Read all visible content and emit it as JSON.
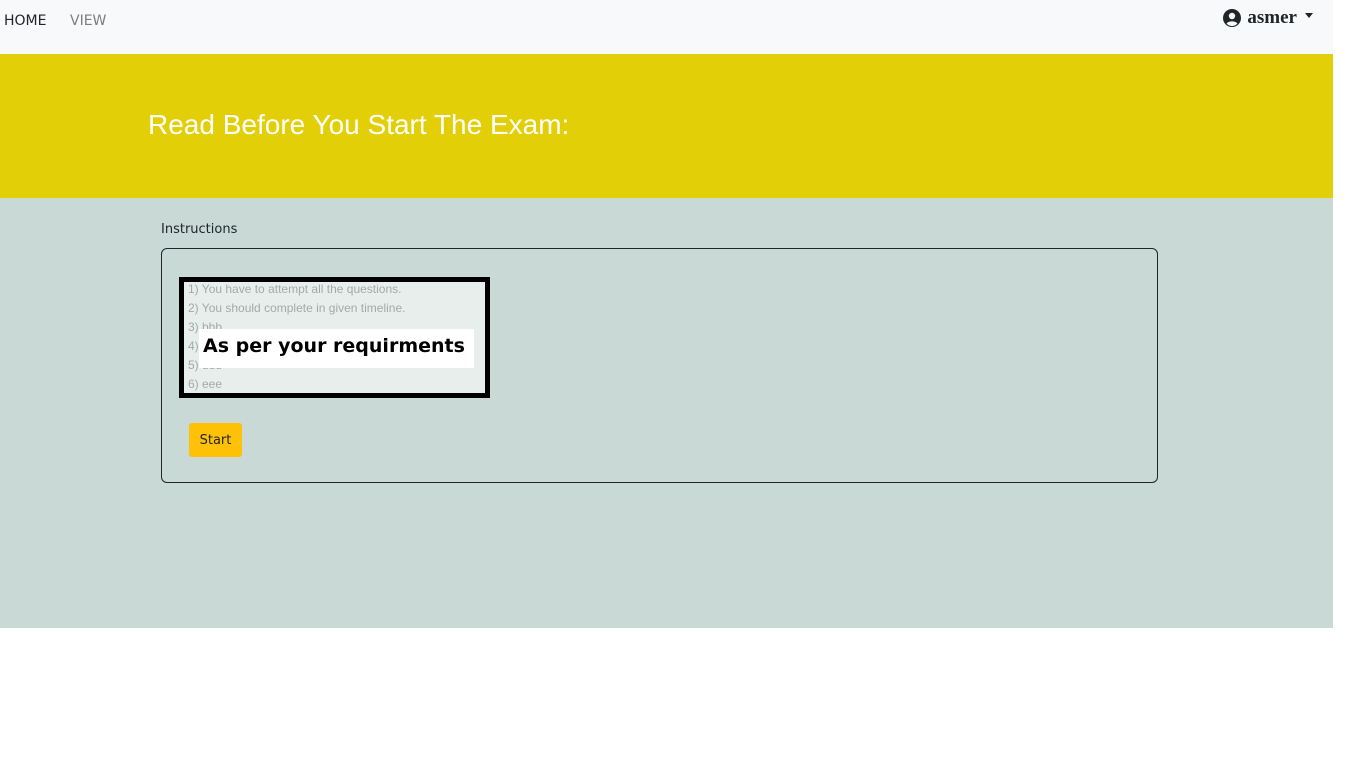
{
  "navbar": {
    "home_label": "HOME",
    "view_label": "VIEW",
    "user_name": "asmer",
    "user_icon": "user-circle-icon"
  },
  "hero": {
    "title": "Read Before You Start The Exam:"
  },
  "instructions": {
    "label": "Instructions",
    "image_lines": [
      "1) You have to attempt all the questions.",
      "2) You should complete in given timeline.",
      "3) bbb",
      "4) ccc",
      "5) ddd",
      "6) eee"
    ],
    "image_overlay_text": "As per your requirments",
    "start_button": "Start"
  },
  "colors": {
    "navbar_bg": "#f8f9fa",
    "hero_bg": "#e3cf07",
    "content_bg": "#c9d9d6",
    "button_bg": "#ffc107"
  }
}
